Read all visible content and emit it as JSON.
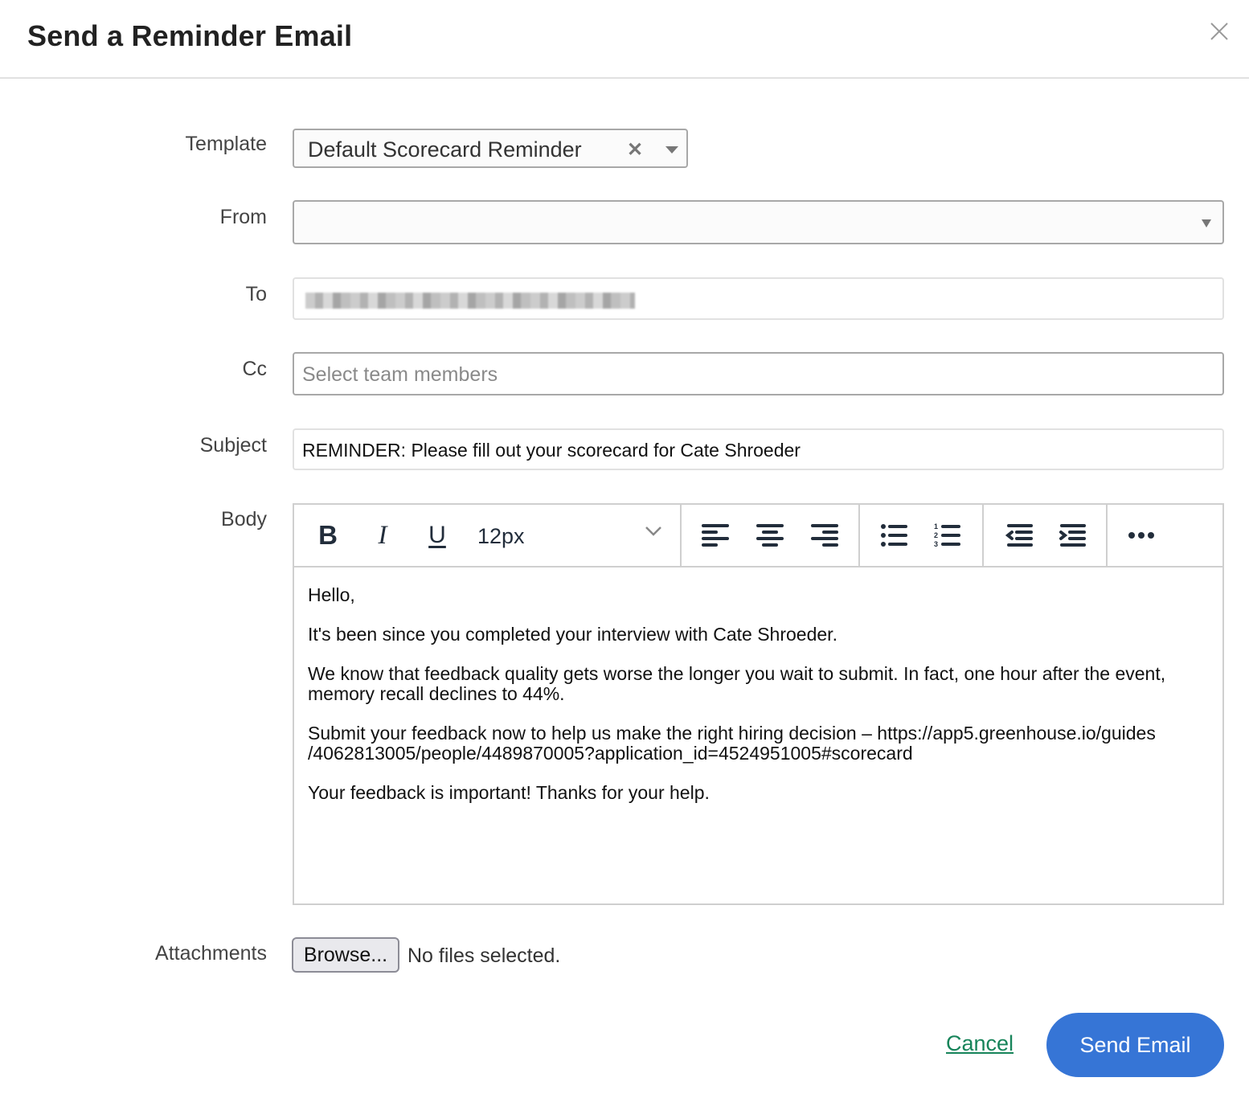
{
  "dialog": {
    "title": "Send a Reminder Email",
    "close_icon": "close-icon"
  },
  "form": {
    "template": {
      "label": "Template",
      "value": "Default Scorecard Reminder",
      "clear_glyph": "✕"
    },
    "from": {
      "label": "From",
      "value": ""
    },
    "to": {
      "label": "To",
      "value": "[redacted email address]"
    },
    "cc": {
      "label": "Cc",
      "placeholder": "Select team members"
    },
    "subject": {
      "label": "Subject",
      "value": "REMINDER: Please fill out your scorecard for Cate Shroeder"
    },
    "body": {
      "label": "Body",
      "toolbar": {
        "bold": "B",
        "italic": "I",
        "underline": "U",
        "font_size": "12px",
        "icons": [
          "bold-icon",
          "italic-icon",
          "underline-icon",
          "chevron-down-icon",
          "align-left-icon",
          "align-center-icon",
          "align-right-icon",
          "bullet-list-icon",
          "numbered-list-icon",
          "outdent-icon",
          "indent-icon",
          "more-icon"
        ]
      },
      "paragraphs": [
        "Hello,",
        "It's been since you completed your interview with Cate Shroeder.",
        "We know that feedback quality gets worse the longer you wait to submit. In fact, one hour after the event, memory recall declines to 44%.",
        "Submit your feedback now to help us make the right hiring decision – https://app5.greenhouse.io/guides /4062813005/people/4489870005?application_id=4524951005#scorecard",
        "Your feedback is important! Thanks for your help."
      ]
    },
    "attachments": {
      "label": "Attachments",
      "browse_label": "Browse...",
      "status": "No files selected."
    }
  },
  "actions": {
    "cancel_label": "Cancel",
    "send_label": "Send Email"
  },
  "colors": {
    "primary": "#3675d6",
    "link": "#17845a",
    "toolbar_icon": "#222d3b"
  }
}
